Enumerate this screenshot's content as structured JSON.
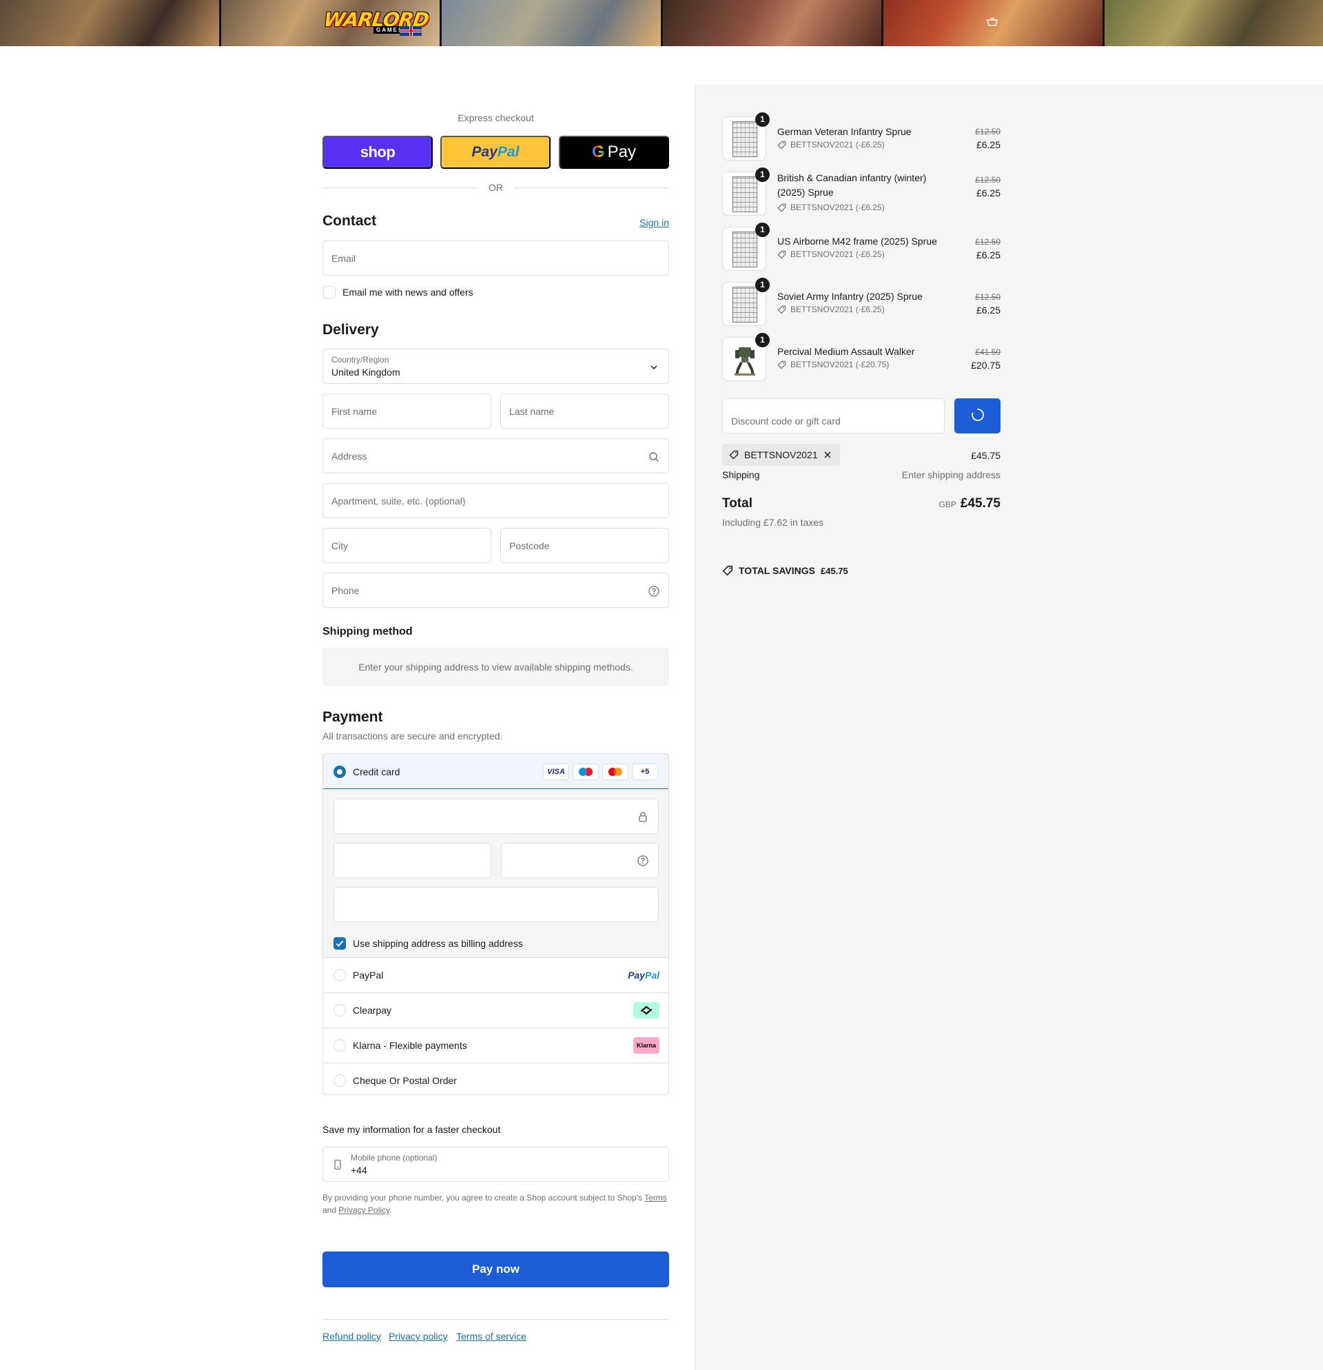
{
  "header": {
    "logo_text": "WARLORD",
    "logo_sub": "GAMES UK"
  },
  "express": {
    "label": "Express checkout",
    "shop_label": "shop",
    "paypal_a": "Pay",
    "paypal_b": "Pal",
    "gpay_g": "G",
    "gpay_label": "Pay",
    "or": "OR"
  },
  "contact": {
    "title": "Contact",
    "sign_in": "Sign in",
    "email_placeholder": "Email",
    "news_label": "Email me with news and offers"
  },
  "delivery": {
    "title": "Delivery",
    "country_label": "Country/Region",
    "country_value": "United Kingdom",
    "first_name": "First name",
    "last_name": "Last name",
    "address": "Address",
    "apartment": "Apartment, suite, etc. (optional)",
    "city": "City",
    "postcode": "Postcode",
    "phone": "Phone"
  },
  "shipping_method": {
    "title": "Shipping method",
    "message": "Enter your shipping address to view available shipping methods."
  },
  "payment": {
    "title": "Payment",
    "subtitle": "All transactions are secure and encrypted.",
    "credit_card": "Credit card",
    "card_logos": [
      "VISA",
      "maestro",
      "mastercard",
      "+5"
    ],
    "billing_label": "Use shipping address as billing address",
    "options": [
      {
        "label": "PayPal",
        "mark_a": "Pay",
        "mark_b": "Pal"
      },
      {
        "label": "Clearpay"
      },
      {
        "label": "Klarna - Flexible payments",
        "mark": "Klarna"
      },
      {
        "label": "Cheque Or Postal Order"
      }
    ]
  },
  "save_info": {
    "title": "Save my information for a faster checkout",
    "mobile_label": "Mobile phone (optional)",
    "mobile_value": "+44",
    "legal_prefix": "By providing your phone number, you agree to create a Shop account subject to Shop's ",
    "terms": "Terms",
    "and": "and ",
    "privacy": "Privacy Policy",
    "period": "."
  },
  "pay_now": "Pay now",
  "footer_links": [
    "Refund policy",
    "Privacy policy",
    "Terms of service"
  ],
  "order": {
    "items": [
      {
        "name": "German Veteran Infantry Sprue",
        "code": "BETTSNOV2021 (-£6.25)",
        "old": "£12.50",
        "price": "£6.25",
        "qty": "1"
      },
      {
        "name": "British & Canadian infantry (winter) (2025) Sprue",
        "code": "BETTSNOV2021 (-£6.25)",
        "old": "£12.50",
        "price": "£6.25",
        "qty": "1"
      },
      {
        "name": "US Airborne M42 frame (2025) Sprue",
        "code": "BETTSNOV2021 (-£6.25)",
        "old": "£12.50",
        "price": "£6.25",
        "qty": "1"
      },
      {
        "name": "Soviet Army Infantry (2025) Sprue",
        "code": "BETTSNOV2021 (-£6.25)",
        "old": "£12.50",
        "price": "£6.25",
        "qty": "1"
      },
      {
        "name": "Percival Medium Assault Walker",
        "code": "BETTSNOV2021 (-£20.75)",
        "old": "£41.50",
        "price": "£20.75",
        "qty": "1"
      }
    ],
    "discount_placeholder": "Discount code or gift card",
    "applied_code": "BETTSNOV2021",
    "subtotal": "£45.75",
    "shipping_label": "Shipping",
    "shipping_value": "Enter shipping address",
    "total_label": "Total",
    "currency": "GBP",
    "total": "£45.75",
    "taxes": "Including £7.62 in taxes",
    "savings_label": "TOTAL SAVINGS",
    "savings_value": "£45.75"
  },
  "colors": {
    "accent": "#1c5cd6",
    "link": "#1773b0",
    "shop": "#5a31f4",
    "paypal": "#ffc439"
  }
}
